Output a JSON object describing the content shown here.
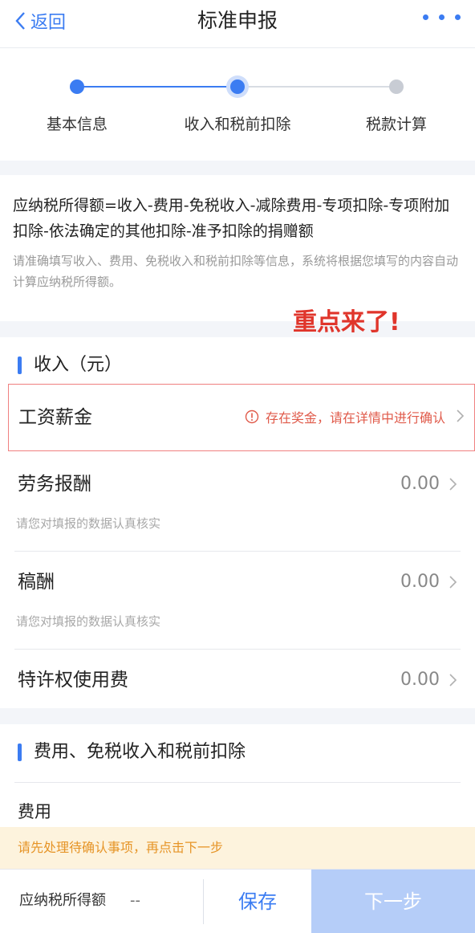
{
  "navbar": {
    "back_label": "返回",
    "title": "标准申报"
  },
  "steps": [
    {
      "label": "基本信息",
      "state": "done"
    },
    {
      "label": "收入和税前扣除",
      "state": "current"
    },
    {
      "label": "税款计算",
      "state": "pending"
    }
  ],
  "formula": {
    "text": "应纳税所得额=收入-费用-免税收入-减除费用-专项扣除-专项附加扣除-依法确定的其他扣除-准予扣除的捐赠额",
    "note": "请准确填写收入、费用、免税收入和税前扣除等信息，系统将根据您填写的内容自动计算应纳税所得额。"
  },
  "annotation": "重点来了!",
  "income": {
    "section_title": "收入（元）",
    "rows": [
      {
        "title": "工资薪金",
        "warning": "存在奖金，请在详情中进行确认"
      },
      {
        "title": "劳务报酬",
        "value": "0.00",
        "hint": "请您对填报的数据认真核实"
      },
      {
        "title": "稿酬",
        "value": "0.00",
        "hint": "请您对填报的数据认真核实"
      },
      {
        "title": "特许权使用费",
        "value": "0.00"
      }
    ]
  },
  "deduction": {
    "section_title": "费用、免税收入和税前扣除",
    "first_row": "费用"
  },
  "notice": "请先处理待确认事项，再点击下一步",
  "bottom": {
    "tax_label": "应纳税所得额",
    "tax_value": "--",
    "save_label": "保存",
    "next_label": "下一步"
  },
  "colors": {
    "accent": "#3b7cf2",
    "warning": "#e05a4a",
    "notice_text": "#e69426",
    "next_disabled": "#b5cdf8"
  }
}
